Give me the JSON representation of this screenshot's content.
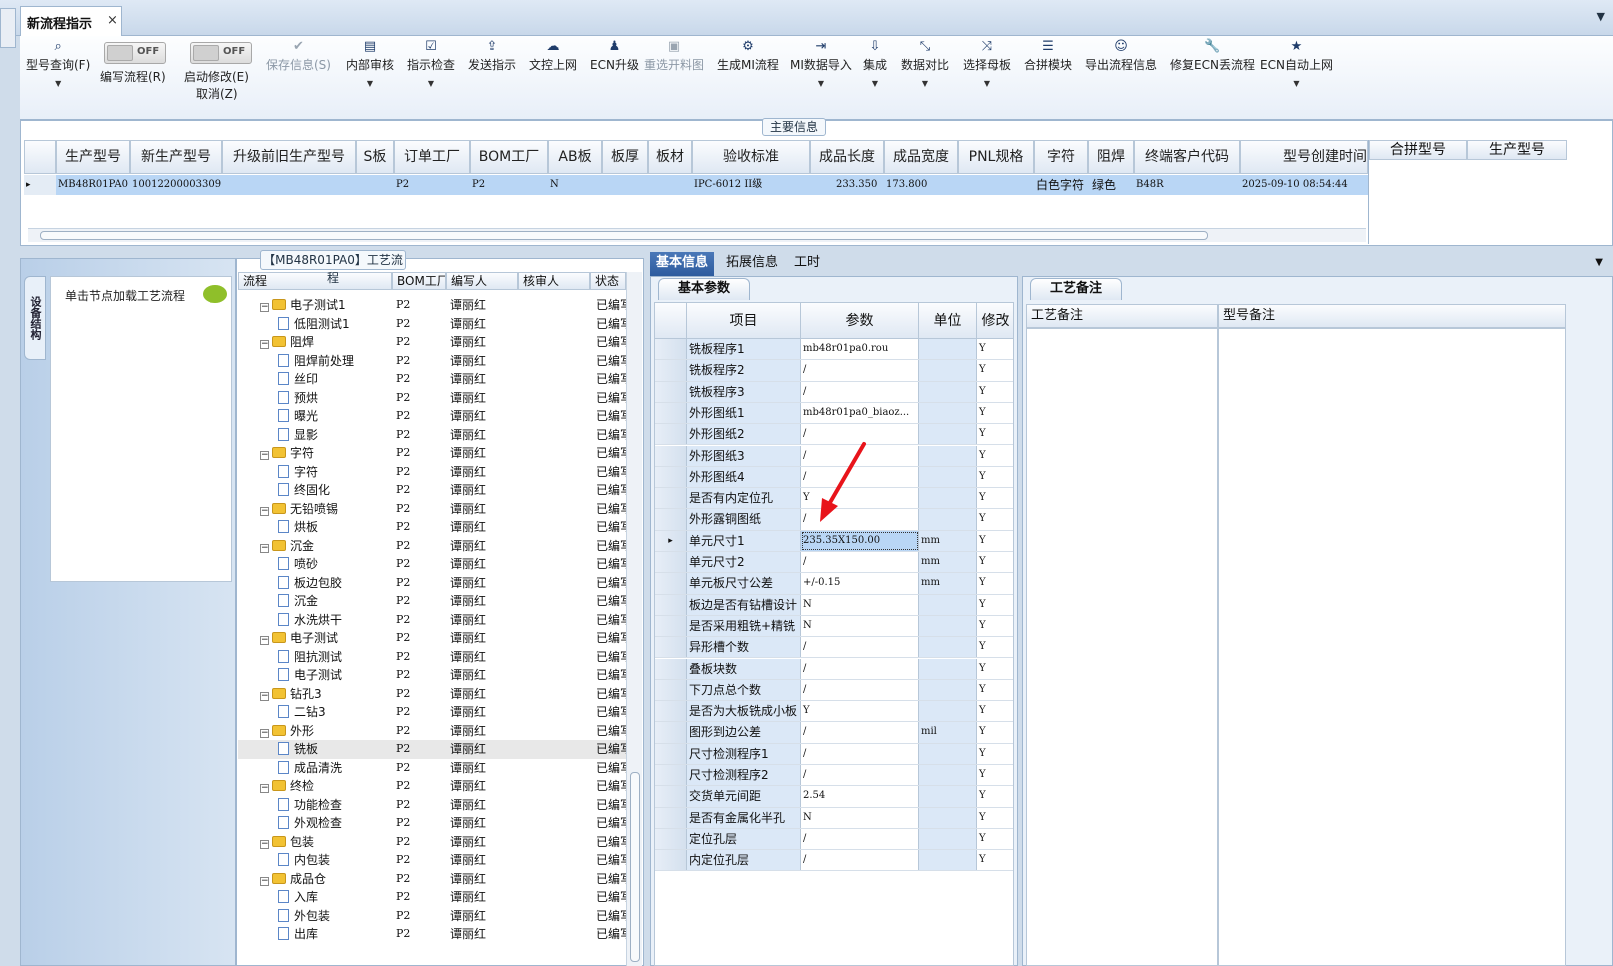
{
  "window": {
    "tab_title": "新流程指示",
    "close_glyph": "×",
    "menu_glyph": "▼"
  },
  "toolbar": {
    "query": "型号查询(F)",
    "write_flow": "编写流程(R)",
    "toggle_off": "OFF",
    "start_modify": "启动修改(E)",
    "cancel": "取消(Z)",
    "save_info": "保存信息(S)",
    "internal_review": "内部审核",
    "instruction_check": "指示检查",
    "send_instruction": "发送指示",
    "upload_doc": "文控上网",
    "ecn_upgrade": "ECN升级",
    "reselect_drawing": "重选开料图",
    "generate_mi": "生成MI流程",
    "mi_import": "MI数据导入",
    "integrate": "集成",
    "data_compare": "数据对比",
    "select_template": "选择母板",
    "merge_module": "合拼模块",
    "export_flow": "导出流程信息",
    "fix_ecn": "修复ECN丢流程",
    "ecn_auto": "ECN自动上网"
  },
  "main_info": {
    "title": "主要信息",
    "columns": [
      "生产型号",
      "新生产型号",
      "升级前旧生产型号",
      "S板",
      "订单工厂",
      "BOM工厂",
      "AB板",
      "板厚",
      "板材",
      "验收标准",
      "成品长度",
      "成品宽度",
      "PNL规格",
      "字符",
      "阻焊",
      "终端客户代码",
      "型号创建时间"
    ],
    "row": {
      "prod_model": "MB48R01PA0",
      "new_model": "10012200003309",
      "order_factory": "P2",
      "bom_factory": "P2",
      "ab_board": "N",
      "standard": "IPC-6012 II级",
      "length": "233.350",
      "width": "173.800",
      "char": "白色字符",
      "mask": "绿色",
      "customer": "B48R",
      "created": "2025-09-10 08:54:44"
    },
    "merge_columns": [
      "合拼型号",
      "生产型号"
    ]
  },
  "sidebar": {
    "vertical_tab": "设备结构",
    "node_hint": "单击节点加载工艺流程"
  },
  "tree": {
    "title": "【MB48R01PA0】工艺流程",
    "columns": [
      "流程",
      "BOM工厂",
      "编写人",
      "核审人",
      "状态"
    ],
    "rows": [
      {
        "name": "电子测试1",
        "type": "folder",
        "factory": "P2",
        "author": "谭丽红",
        "status": "已编写"
      },
      {
        "name": "低阻测试1",
        "type": "doc",
        "factory": "P2",
        "author": "谭丽红",
        "status": "已编写"
      },
      {
        "name": "阻焊",
        "type": "folder",
        "factory": "P2",
        "author": "谭丽红",
        "status": "已编写"
      },
      {
        "name": "阻焊前处理",
        "type": "doc",
        "factory": "P2",
        "author": "谭丽红",
        "status": "已编写"
      },
      {
        "name": "丝印",
        "type": "doc",
        "factory": "P2",
        "author": "谭丽红",
        "status": "已编写"
      },
      {
        "name": "预烘",
        "type": "doc",
        "factory": "P2",
        "author": "谭丽红",
        "status": "已编写"
      },
      {
        "name": "曝光",
        "type": "doc",
        "factory": "P2",
        "author": "谭丽红",
        "status": "已编写"
      },
      {
        "name": "显影",
        "type": "doc",
        "factory": "P2",
        "author": "谭丽红",
        "status": "已编写"
      },
      {
        "name": "字符",
        "type": "folder",
        "factory": "P2",
        "author": "谭丽红",
        "status": "已编写"
      },
      {
        "name": "字符",
        "type": "doc",
        "factory": "P2",
        "author": "谭丽红",
        "status": "已编写"
      },
      {
        "name": "终固化",
        "type": "doc",
        "factory": "P2",
        "author": "谭丽红",
        "status": "已编写"
      },
      {
        "name": "无铅喷锡",
        "type": "folder",
        "factory": "P2",
        "author": "谭丽红",
        "status": "已编写"
      },
      {
        "name": "烘板",
        "type": "doc",
        "factory": "P2",
        "author": "谭丽红",
        "status": "已编写"
      },
      {
        "name": "沉金",
        "type": "folder",
        "factory": "P2",
        "author": "谭丽红",
        "status": "已编写"
      },
      {
        "name": "喷砂",
        "type": "doc",
        "factory": "P2",
        "author": "谭丽红",
        "status": "已编写"
      },
      {
        "name": "板边包胶",
        "type": "doc",
        "factory": "P2",
        "author": "谭丽红",
        "status": "已编写"
      },
      {
        "name": "沉金",
        "type": "doc",
        "factory": "P2",
        "author": "谭丽红",
        "status": "已编写"
      },
      {
        "name": "水洗烘干",
        "type": "doc",
        "factory": "P2",
        "author": "谭丽红",
        "status": "已编写"
      },
      {
        "name": "电子测试",
        "type": "folder",
        "factory": "P2",
        "author": "谭丽红",
        "status": "已编写"
      },
      {
        "name": "阻抗测试",
        "type": "doc",
        "factory": "P2",
        "author": "谭丽红",
        "status": "已编写"
      },
      {
        "name": "电子测试",
        "type": "doc",
        "factory": "P2",
        "author": "谭丽红",
        "status": "已编写"
      },
      {
        "name": "钻孔3",
        "type": "folder",
        "factory": "P2",
        "author": "谭丽红",
        "status": "已编写"
      },
      {
        "name": "二钻3",
        "type": "doc",
        "factory": "P2",
        "author": "谭丽红",
        "status": "已编写"
      },
      {
        "name": "外形",
        "type": "folder",
        "factory": "P2",
        "author": "谭丽红",
        "status": "已编写"
      },
      {
        "name": "铣板",
        "type": "doc",
        "factory": "P2",
        "author": "谭丽红",
        "status": "已编写",
        "selected": true
      },
      {
        "name": "成品清洗",
        "type": "doc",
        "factory": "P2",
        "author": "谭丽红",
        "status": "已编写"
      },
      {
        "name": "终检",
        "type": "folder",
        "factory": "P2",
        "author": "谭丽红",
        "status": "已编写"
      },
      {
        "name": "功能检查",
        "type": "doc",
        "factory": "P2",
        "author": "谭丽红",
        "status": "已编写"
      },
      {
        "name": "外观检查",
        "type": "doc",
        "factory": "P2",
        "author": "谭丽红",
        "status": "已编写"
      },
      {
        "name": "包装",
        "type": "folder",
        "factory": "P2",
        "author": "谭丽红",
        "status": "已编写"
      },
      {
        "name": "内包装",
        "type": "doc",
        "factory": "P2",
        "author": "谭丽红",
        "status": "已编写"
      },
      {
        "name": "成品仓",
        "type": "folder",
        "factory": "P2",
        "author": "谭丽红",
        "status": "已编写"
      },
      {
        "name": "入库",
        "type": "doc",
        "factory": "P2",
        "author": "谭丽红",
        "status": "已编写"
      },
      {
        "name": "外包装",
        "type": "doc",
        "factory": "P2",
        "author": "谭丽红",
        "status": "已编写"
      },
      {
        "name": "出库",
        "type": "doc",
        "factory": "P2",
        "author": "谭丽红",
        "status": "已编写"
      }
    ]
  },
  "right_tabs": [
    "基本信息",
    "拓展信息",
    "工时"
  ],
  "params": {
    "tab": "基本参数",
    "columns": [
      "项目",
      "参数",
      "单位",
      "修改"
    ],
    "rows": [
      {
        "item": "铣板程序1",
        "value": "mb48r01pa0.rou",
        "unit": "",
        "mod": "Y"
      },
      {
        "item": "铣板程序2",
        "value": "/",
        "unit": "",
        "mod": "Y"
      },
      {
        "item": "铣板程序3",
        "value": "/",
        "unit": "",
        "mod": "Y"
      },
      {
        "item": "外形图纸1",
        "value": "mb48r01pa0_biaoz...",
        "unit": "",
        "mod": "Y"
      },
      {
        "item": "外形图纸2",
        "value": "/",
        "unit": "",
        "mod": "Y"
      },
      {
        "item": "外形图纸3",
        "value": "/",
        "unit": "",
        "mod": "Y"
      },
      {
        "item": "外形图纸4",
        "value": "/",
        "unit": "",
        "mod": "Y"
      },
      {
        "item": "是否有内定位孔",
        "value": "Y",
        "unit": "",
        "mod": "Y"
      },
      {
        "item": "外形露铜图纸",
        "value": "/",
        "unit": "",
        "mod": "Y"
      },
      {
        "item": "单元尺寸1",
        "value": "235.35X150.00",
        "unit": "mm",
        "mod": "Y",
        "current": true
      },
      {
        "item": "单元尺寸2",
        "value": "/",
        "unit": "mm",
        "mod": "Y"
      },
      {
        "item": "单元板尺寸公差",
        "value": "+/-0.15",
        "unit": "mm",
        "mod": "Y"
      },
      {
        "item": "板边是否有钻槽设计",
        "value": "N",
        "unit": "",
        "mod": "Y"
      },
      {
        "item": "是否采用粗铣+精铣",
        "value": "N",
        "unit": "",
        "mod": "Y"
      },
      {
        "item": "异形槽个数",
        "value": "/",
        "unit": "",
        "mod": "Y"
      },
      {
        "item": "叠板块数",
        "value": "/",
        "unit": "",
        "mod": "Y"
      },
      {
        "item": "下刀点总个数",
        "value": "/",
        "unit": "",
        "mod": "Y"
      },
      {
        "item": "是否为大板铣成小板",
        "value": "Y",
        "unit": "",
        "mod": "Y"
      },
      {
        "item": "图形到边公差",
        "value": "/",
        "unit": "mil",
        "mod": "Y"
      },
      {
        "item": "尺寸检测程序1",
        "value": "/",
        "unit": "",
        "mod": "Y"
      },
      {
        "item": "尺寸检测程序2",
        "value": "/",
        "unit": "",
        "mod": "Y"
      },
      {
        "item": "交货单元间距",
        "value": "2.54",
        "unit": "",
        "mod": "Y"
      },
      {
        "item": "是否有金属化半孔",
        "value": "N",
        "unit": "",
        "mod": "Y"
      },
      {
        "item": "定位孔层",
        "value": "/",
        "unit": "",
        "mod": "Y"
      },
      {
        "item": "内定位孔层",
        "value": "/",
        "unit": "",
        "mod": "Y"
      }
    ]
  },
  "notes": {
    "tab": "工艺备注",
    "col1": "工艺备注",
    "col2": "型号备注"
  },
  "colors": {
    "accent": "#2d5b9e",
    "selection": "#b9d6f5",
    "annotation_arrow": "#e8141b"
  }
}
